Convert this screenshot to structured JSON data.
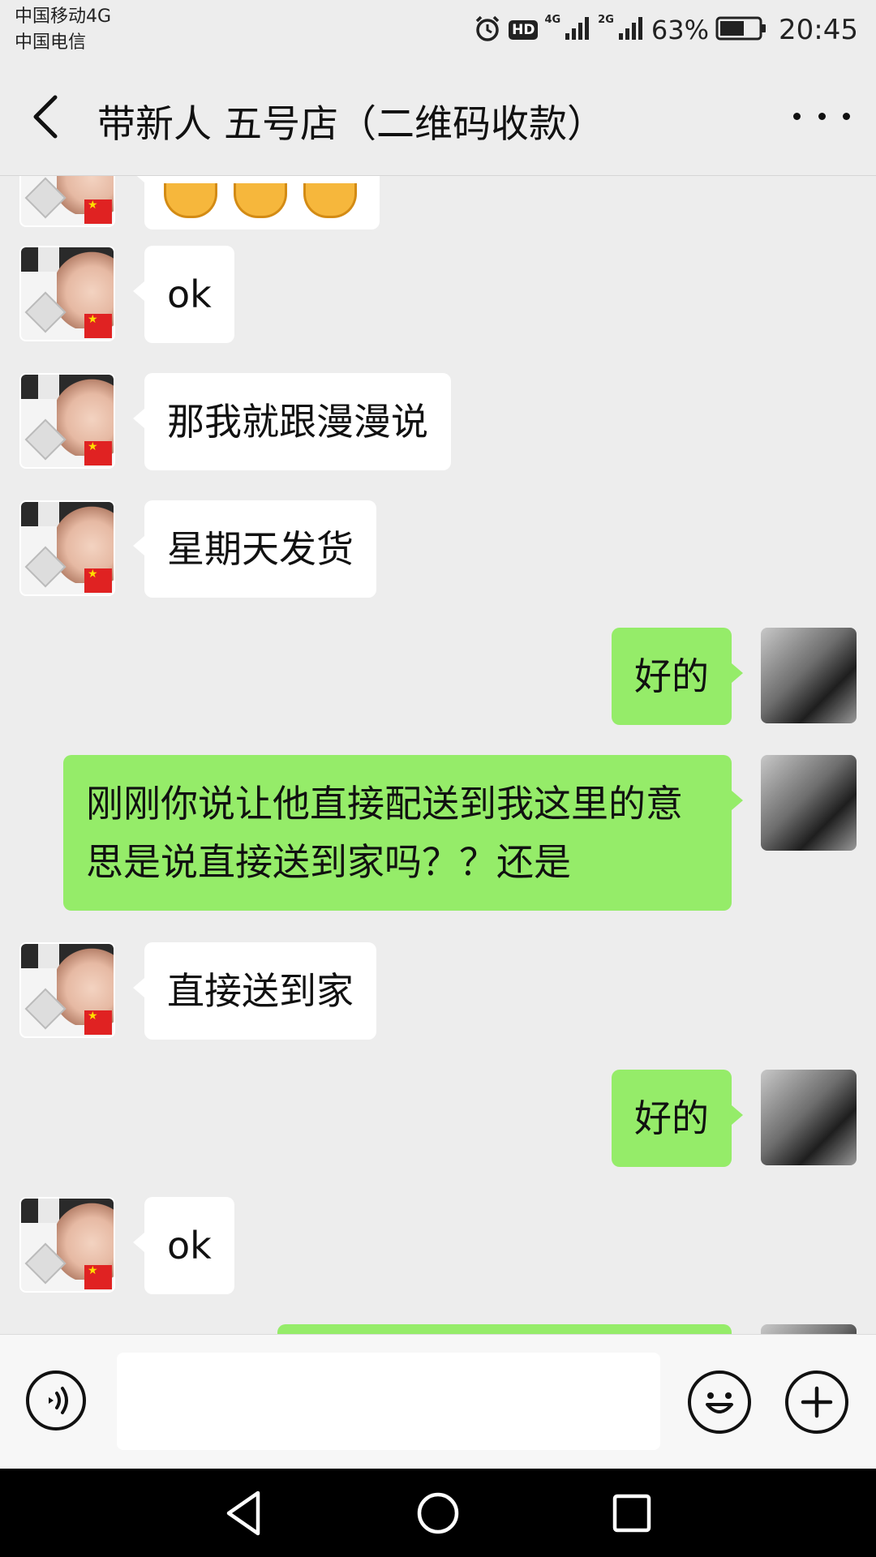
{
  "status_bar": {
    "carrier_1": "中国移动4G",
    "carrier_2": "中国电信",
    "hd_badge": "HD",
    "net_1": "4G",
    "net_2": "2G",
    "battery_percent": "63%",
    "battery_level": 0.63,
    "time": "20:45",
    "icons": [
      "alarm-icon",
      "hd-icon",
      "signal-icon",
      "signal-icon",
      "battery-icon"
    ]
  },
  "header": {
    "title": "带新人 五号店（二维码收款）",
    "back_icon": "chevron-left-icon",
    "more_icon": "more-dots-icon"
  },
  "messages": [
    {
      "side": "in",
      "kind": "emoji",
      "content": "laughing-emoji x3"
    },
    {
      "side": "in",
      "text": "ok"
    },
    {
      "side": "in",
      "text": "那我就跟漫漫说"
    },
    {
      "side": "in",
      "text": "星期天发货"
    },
    {
      "side": "out",
      "text": "好的"
    },
    {
      "side": "out",
      "text": "刚刚你说让他直接配送到我这里的意思是说直接送到家吗？？还是"
    },
    {
      "side": "in",
      "text": "直接送到家"
    },
    {
      "side": "out",
      "text": "好的"
    },
    {
      "side": "in",
      "text": "ok"
    }
  ],
  "input_bar": {
    "voice_icon": "voice-icon",
    "text_value": "",
    "emoji_icon": "smiley-icon",
    "plus_icon": "plus-icon"
  },
  "nav_bar": {
    "icons": [
      "nav-back-icon",
      "nav-home-icon",
      "nav-recent-icon"
    ]
  },
  "colors": {
    "background": "#ededed",
    "bubble_out": "#95ec69",
    "bubble_in": "#ffffff"
  }
}
